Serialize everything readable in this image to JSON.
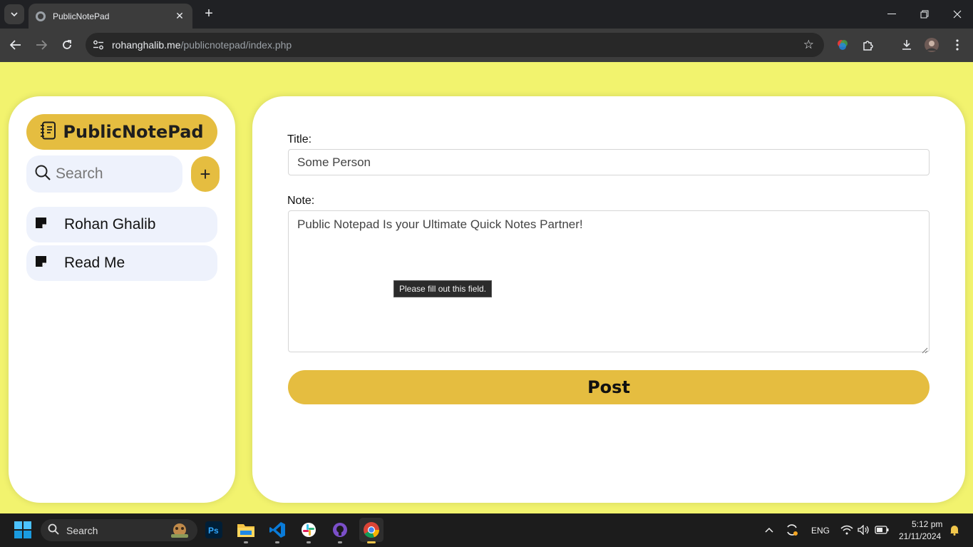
{
  "browser": {
    "tab_title": "PublicNotePad",
    "url_host": "rohanghalib.me",
    "url_path": "/publicnotepad/index.php"
  },
  "sidebar": {
    "logo_text": "PublicNotePad",
    "search_placeholder": "Search",
    "add_label": "+",
    "notes": [
      {
        "label": "Rohan Ghalib"
      },
      {
        "label": "Read Me"
      }
    ]
  },
  "form": {
    "title_label": "Title:",
    "title_value": "Some Person",
    "note_label": "Note:",
    "note_value": "Public Notepad Is your Ultimate Quick Notes Partner!",
    "post_label": "Post",
    "validation_tooltip": "Please fill out this field."
  },
  "taskbar": {
    "search_label": "Search",
    "language": "ENG",
    "time": "5:12 pm",
    "date": "21/11/2024"
  },
  "colors": {
    "page_bg": "#f2f36e",
    "accent": "#e5bd40",
    "item_bg": "#eef2fc"
  }
}
